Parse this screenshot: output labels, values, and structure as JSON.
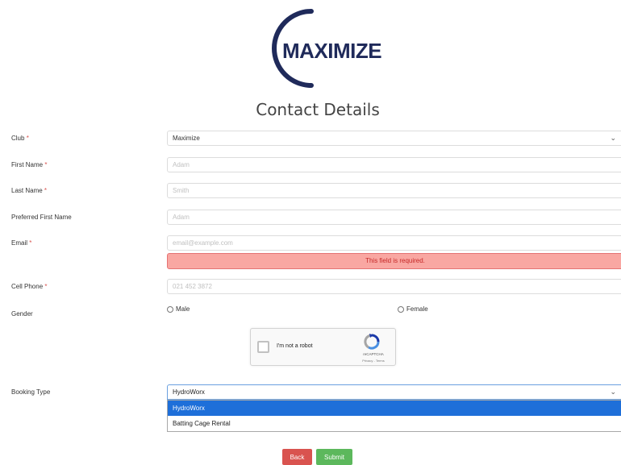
{
  "logo": {
    "text": "MAXIMIZE"
  },
  "page_title": "Contact Details",
  "required_mark": "*",
  "fields": {
    "club": {
      "label": "Club",
      "value": "Maximize"
    },
    "first_name": {
      "label": "First Name",
      "placeholder": "Adam"
    },
    "last_name": {
      "label": "Last Name",
      "placeholder": "Smith"
    },
    "preferred_first_name": {
      "label": "Preferred First Name",
      "placeholder": "Adam"
    },
    "email": {
      "label": "Email",
      "placeholder": "email@example.com",
      "error": "This field is required."
    },
    "cell_phone": {
      "label": "Cell Phone",
      "placeholder": "021 452 3872"
    },
    "gender": {
      "label": "Gender",
      "options": [
        "Male",
        "Female"
      ]
    },
    "booking_type": {
      "label": "Booking Type",
      "value": "HydroWorx",
      "options": [
        "HydroWorx",
        "Batting Cage Rental"
      ]
    }
  },
  "captcha": {
    "label": "I'm not a robot",
    "brand": "reCAPTCHA",
    "terms": "Privacy - Terms"
  },
  "buttons": {
    "back": "Back",
    "submit": "Submit"
  },
  "colors": {
    "brand": "#1f2a5a",
    "error_bg": "#f9a7a2",
    "error_text": "#c62828",
    "back": "#d9534f",
    "submit": "#5cb85c",
    "selected_option": "#1e6fd9"
  }
}
